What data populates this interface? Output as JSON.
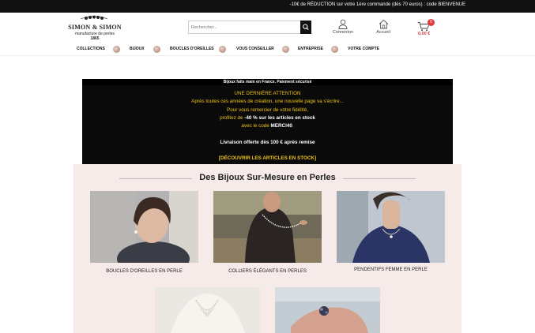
{
  "topbar": {
    "message": "-10€ de RÉDUCTION sur votre 1ère commande (dès 70 euros) : code BIENVENUE"
  },
  "logo": {
    "name": "SIMON & SIMON",
    "subtitle": "manufacture de perles",
    "year": "1865"
  },
  "search": {
    "placeholder": "Rechercher..."
  },
  "header_links": {
    "account_label": "Connexion",
    "home_label": "Accueil"
  },
  "cart": {
    "count": "0",
    "amount": "0,00 €"
  },
  "nav": [
    "Collections",
    "Bijoux",
    "Boucles d'oreilles",
    "Vous conseiller",
    "Entreprise",
    "Votre compte"
  ],
  "promo": {
    "top": "Bijoux faits main en France. Paiement sécurisé",
    "line1": "UNE DERNIÈRE ATTENTION",
    "line2": "Après toutes ces années de création, une nouvelle page va s'écrire...",
    "line3": "Pour vous remercier de votre fidélité,",
    "line4_a": "profitez de ",
    "line4_b": "-40 % sur les articles en stock",
    "line5_a": "avec le code ",
    "line5_b": "MERCI40",
    "line5_c": ".",
    "line6": "Livraison offerte dès 100 € après remise",
    "cta": "[DÉCOUVRIR LES ARTICLES EN STOCK]"
  },
  "section": {
    "title": "Des Bijoux Sur-Mesure en Perles",
    "cards": [
      {
        "caption": "Boucles d'oreilles en perle"
      },
      {
        "caption": "Colliers élégants en perles"
      },
      {
        "caption": "Pendentifs femme en perle"
      }
    ]
  }
}
